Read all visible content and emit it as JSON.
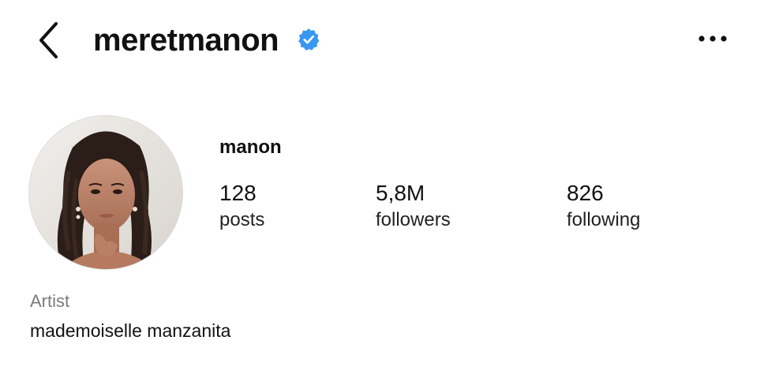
{
  "header": {
    "back_icon": "chevron-left-icon",
    "username": "meretmanon",
    "verified": true,
    "verified_color": "#3897f0",
    "more_icon": "more-horizontal-icon"
  },
  "profile": {
    "avatar_description_icon": "avatar-photo",
    "display_name": "manon",
    "stats": {
      "posts": {
        "value": "128",
        "label": "posts"
      },
      "followers": {
        "value": "5,8M",
        "label": "followers"
      },
      "following": {
        "value": "826",
        "label": "following"
      }
    },
    "category": "Artist",
    "bio": "mademoiselle manzanita"
  }
}
